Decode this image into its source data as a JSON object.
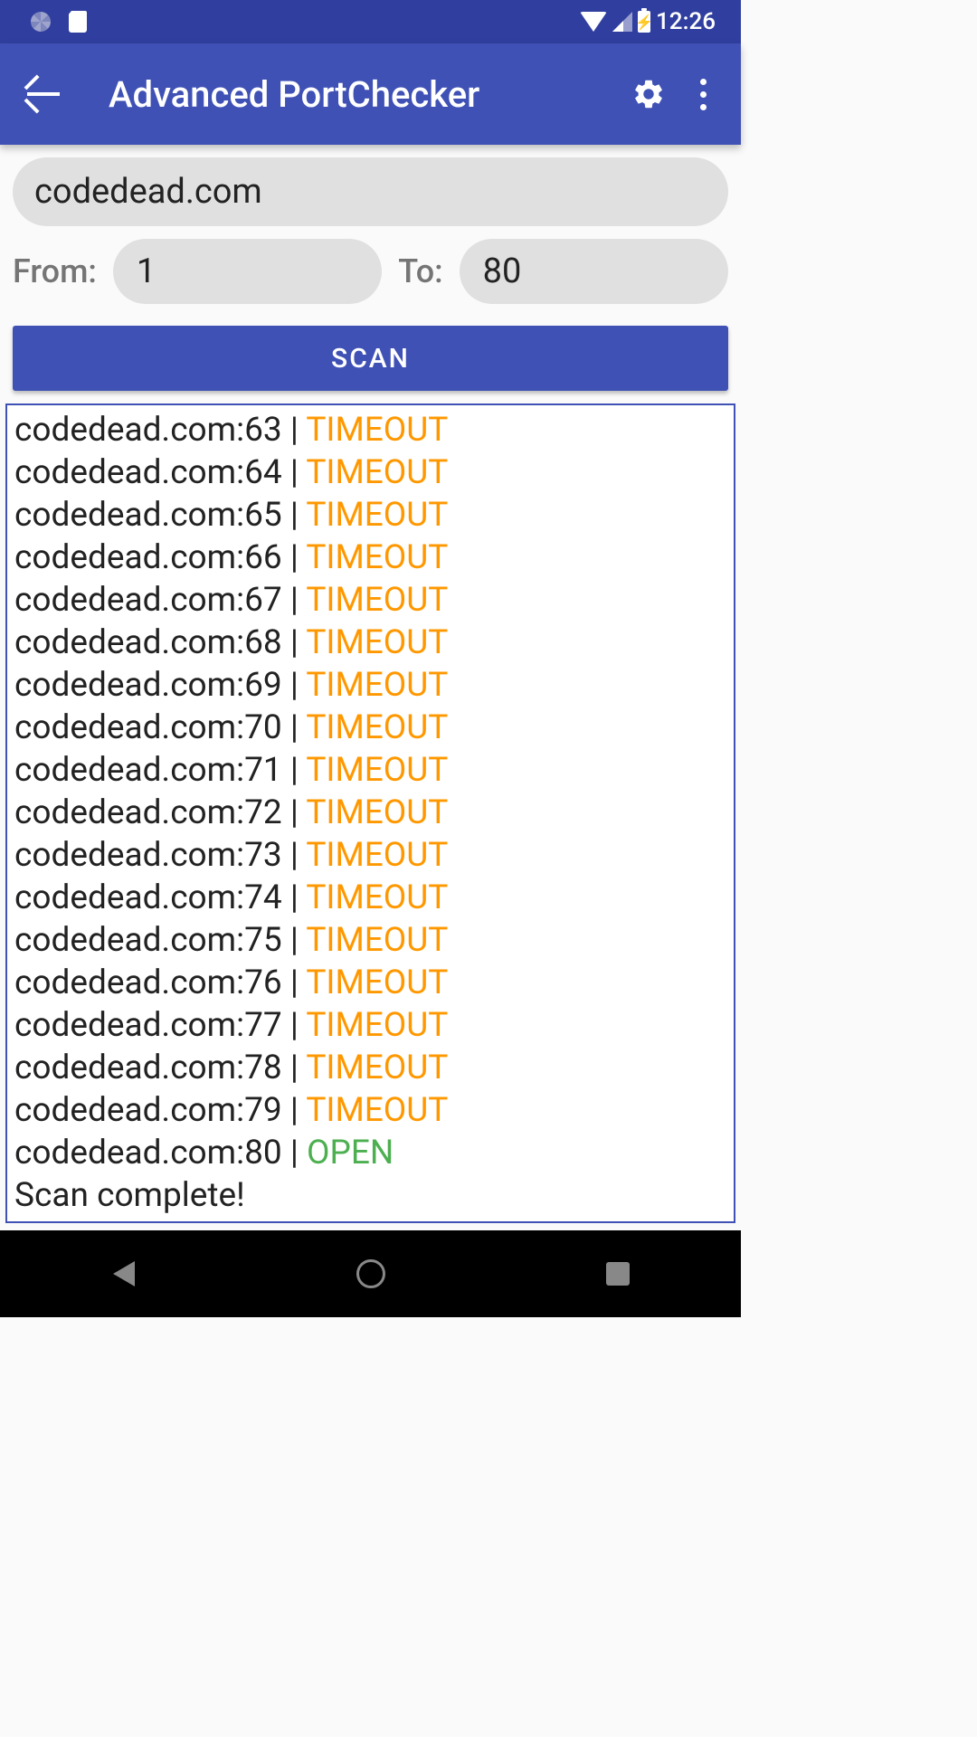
{
  "status_bar": {
    "time": "12:26"
  },
  "app_bar": {
    "title": "Advanced PortChecker"
  },
  "inputs": {
    "host": "codedead.com",
    "from_label": "From:",
    "from_value": "1",
    "to_label": "To:",
    "to_value": "80"
  },
  "scan_button": "SCAN",
  "results": {
    "host": "codedead.com",
    "rows": [
      {
        "port": 63,
        "status": "TIMEOUT",
        "cut": true
      },
      {
        "port": 64,
        "status": "TIMEOUT"
      },
      {
        "port": 65,
        "status": "TIMEOUT"
      },
      {
        "port": 66,
        "status": "TIMEOUT"
      },
      {
        "port": 67,
        "status": "TIMEOUT"
      },
      {
        "port": 68,
        "status": "TIMEOUT"
      },
      {
        "port": 69,
        "status": "TIMEOUT"
      },
      {
        "port": 70,
        "status": "TIMEOUT"
      },
      {
        "port": 71,
        "status": "TIMEOUT"
      },
      {
        "port": 72,
        "status": "TIMEOUT"
      },
      {
        "port": 73,
        "status": "TIMEOUT"
      },
      {
        "port": 74,
        "status": "TIMEOUT"
      },
      {
        "port": 75,
        "status": "TIMEOUT"
      },
      {
        "port": 76,
        "status": "TIMEOUT"
      },
      {
        "port": 77,
        "status": "TIMEOUT"
      },
      {
        "port": 78,
        "status": "TIMEOUT"
      },
      {
        "port": 79,
        "status": "TIMEOUT"
      },
      {
        "port": 80,
        "status": "OPEN"
      }
    ],
    "complete_msg": "Scan complete!"
  }
}
